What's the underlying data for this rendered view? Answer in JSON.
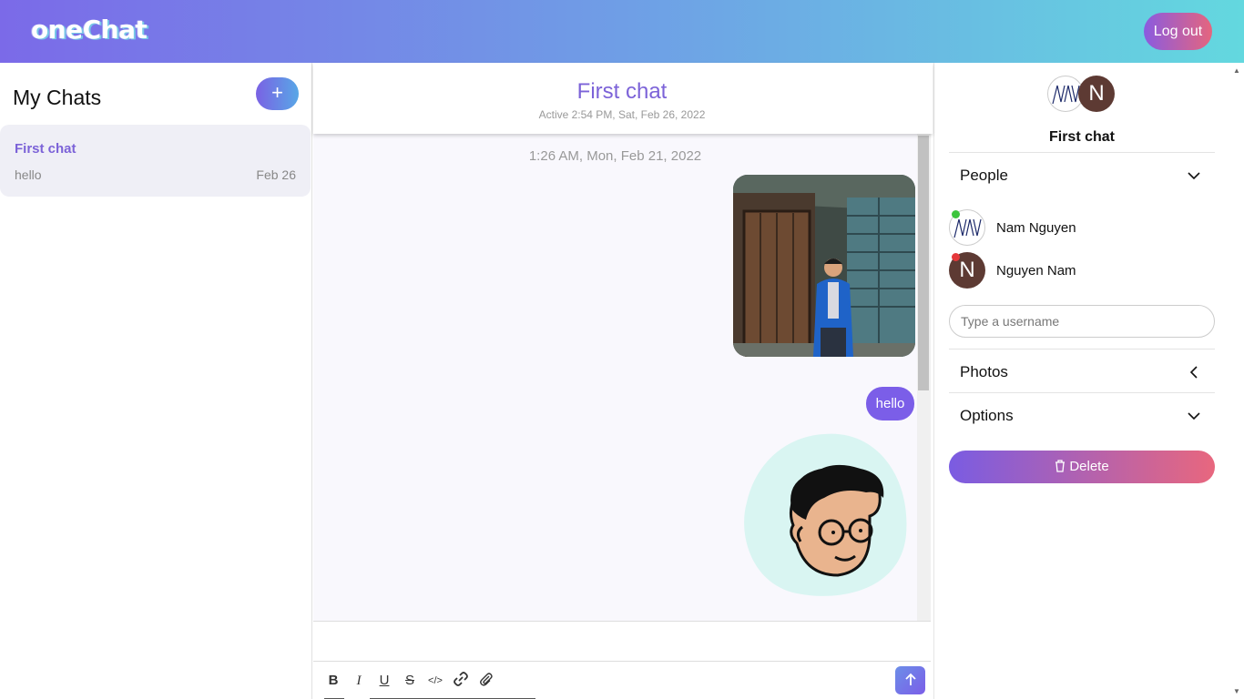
{
  "app": {
    "logo": "oneChat",
    "logout_label": "Log out"
  },
  "sidebar": {
    "title": "My Chats",
    "add_label": "+",
    "chats": [
      {
        "title": "First chat",
        "preview": "hello",
        "date": "Feb 26"
      }
    ]
  },
  "chat": {
    "title": "First chat",
    "active": "Active 2:54 PM, Sat, Feb 26, 2022",
    "timestamp": "1:26 AM, Mon, Feb 21, 2022",
    "messages": [
      {
        "type": "image",
        "desc": "photo"
      },
      {
        "type": "text",
        "text": "hello"
      },
      {
        "type": "image",
        "desc": "sticker"
      }
    ],
    "toolbar": [
      "B",
      "I",
      "U",
      "S",
      "</>",
      "link",
      "attach"
    ],
    "send_icon": "arrow-up-icon"
  },
  "settings": {
    "title": "First chat",
    "people_label": "People",
    "people": [
      {
        "name": "Nam Nguyen",
        "status_color": "#3cc43c"
      },
      {
        "name": "Nguyen Nam",
        "status_color": "#e5383b",
        "initial": "N"
      }
    ],
    "username_placeholder": "Type a username",
    "photos_label": "Photos",
    "options_label": "Options",
    "delete_label": "Delete",
    "avatar_initial": "N"
  },
  "colors": {
    "accent": "#7c63d8",
    "bubble": "#7b5ee8"
  }
}
